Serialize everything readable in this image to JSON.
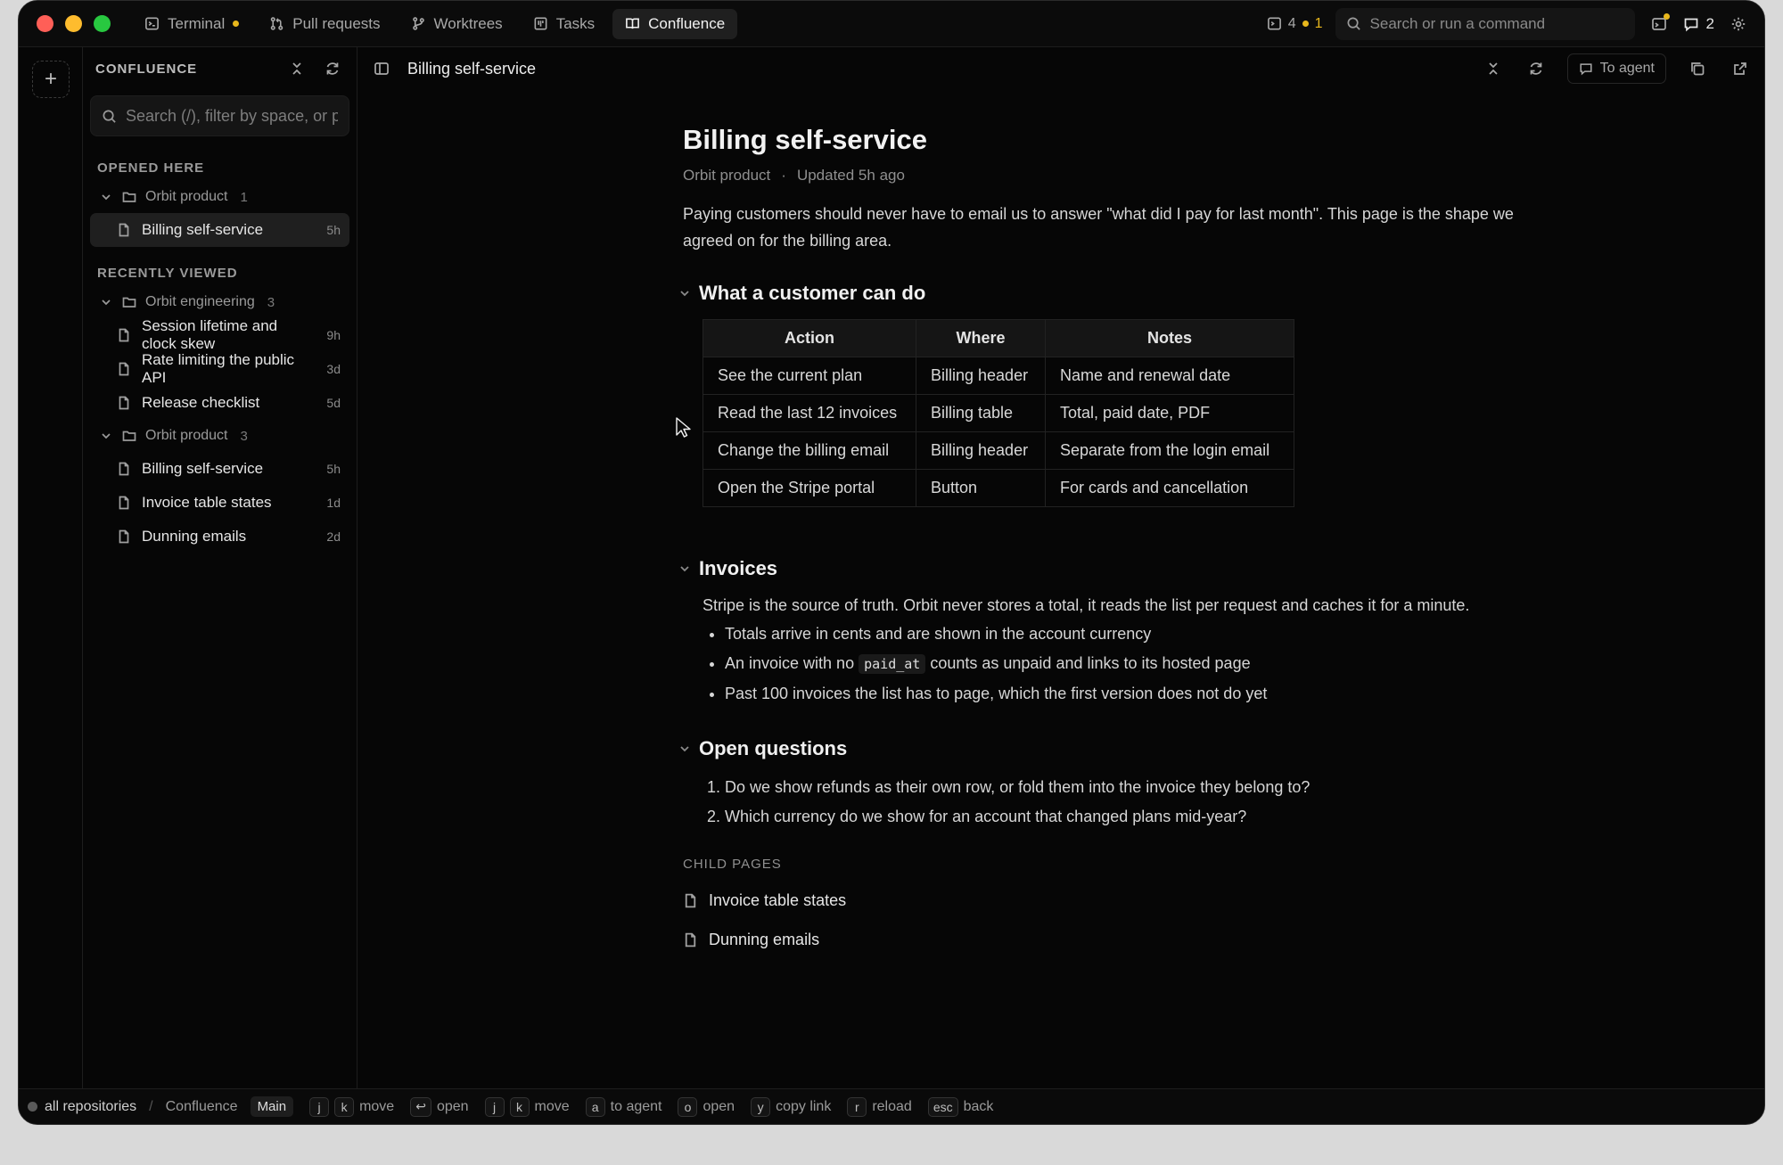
{
  "window": {
    "traffic_lights": {
      "close": "#ff5f57",
      "minimize": "#febc2e",
      "zoom": "#28c840"
    }
  },
  "topbar": {
    "tabs": [
      {
        "label": "Terminal",
        "icon": "terminal-icon",
        "has_dot": true
      },
      {
        "label": "Pull requests",
        "icon": "pull-request-icon"
      },
      {
        "label": "Worktrees",
        "icon": "branch-icon"
      },
      {
        "label": "Tasks",
        "icon": "board-icon"
      },
      {
        "label": "Confluence",
        "icon": "book-icon",
        "active": true
      }
    ],
    "counter": {
      "count": "4",
      "warn_count": "1"
    },
    "search_placeholder": "Search or run a command",
    "messages_count": "2",
    "accent_warn": "#e8b71c"
  },
  "sidebar": {
    "title": "CONFLUENCE",
    "search_placeholder": "Search (/), filter by space, or paste a page link",
    "opened_here": {
      "label": "OPENED HERE",
      "group": {
        "name": "Orbit product",
        "count": "1"
      },
      "items": [
        {
          "title": "Billing self-service",
          "age": "5h",
          "selected": true
        }
      ]
    },
    "recently_viewed": {
      "label": "RECENTLY VIEWED",
      "groups": [
        {
          "name": "Orbit engineering",
          "count": "3",
          "items": [
            {
              "title": "Session lifetime and clock skew",
              "age": "9h"
            },
            {
              "title": "Rate limiting the public API",
              "age": "3d"
            },
            {
              "title": "Release checklist",
              "age": "5d"
            }
          ]
        },
        {
          "name": "Orbit product",
          "count": "3",
          "items": [
            {
              "title": "Billing self-service",
              "age": "5h"
            },
            {
              "title": "Invoice table states",
              "age": "1d"
            },
            {
              "title": "Dunning emails",
              "age": "2d"
            }
          ]
        }
      ]
    }
  },
  "main": {
    "breadcrumb": "Billing self-service",
    "to_agent_label": "To agent",
    "page": {
      "title": "Billing self-service",
      "space": "Orbit product",
      "updated": "Updated 5h ago",
      "intro": "Paying customers should never have to email us to answer \"what did I pay for last month\". This page is the shape we agreed on for the billing area.",
      "section1": {
        "heading": "What a customer can do",
        "columns": [
          "Action",
          "Where",
          "Notes"
        ],
        "rows": [
          [
            "See the current plan",
            "Billing header",
            "Name and renewal date"
          ],
          [
            "Read the last 12 invoices",
            "Billing table",
            "Total, paid date, PDF"
          ],
          [
            "Change the billing email",
            "Billing header",
            "Separate from the login email"
          ],
          [
            "Open the Stripe portal",
            "Button",
            "For cards and cancellation"
          ]
        ]
      },
      "section2": {
        "heading": "Invoices",
        "para": "Stripe is the source of truth. Orbit never stores a total, it reads the list per request and caches it for a minute.",
        "bullets": {
          "b1": "Totals arrive in cents and are shown in the account currency",
          "b2_pre": "An invoice with no",
          "b2_code": "paid_at",
          "b2_post": "counts as unpaid and links to its hosted page",
          "b3": "Past 100 invoices the list has to page, which the first version does not do yet"
        }
      },
      "section3": {
        "heading": "Open questions",
        "items": [
          "Do we show refunds as their own row, or fold them into the invoice they belong to?",
          "Which currency do we show for an account that changed plans mid-year?"
        ]
      },
      "child_pages": {
        "label": "CHILD PAGES",
        "items": [
          "Invoice table states",
          "Dunning emails"
        ]
      }
    }
  },
  "statusbar": {
    "repo": "all repositories",
    "app": "Confluence",
    "branch": "Main",
    "hints": [
      {
        "keys": [
          "j",
          "k"
        ],
        "label": "move"
      },
      {
        "keys": [
          "↩"
        ],
        "label": "open"
      },
      {
        "keys": [
          "j",
          "k"
        ],
        "label": "move"
      },
      {
        "keys": [
          "a"
        ],
        "label": "to agent"
      },
      {
        "keys": [
          "o"
        ],
        "label": "open"
      },
      {
        "keys": [
          "y"
        ],
        "label": "copy link"
      },
      {
        "keys": [
          "r"
        ],
        "label": "reload"
      },
      {
        "keys": [
          "esc"
        ],
        "label": "back"
      }
    ]
  }
}
